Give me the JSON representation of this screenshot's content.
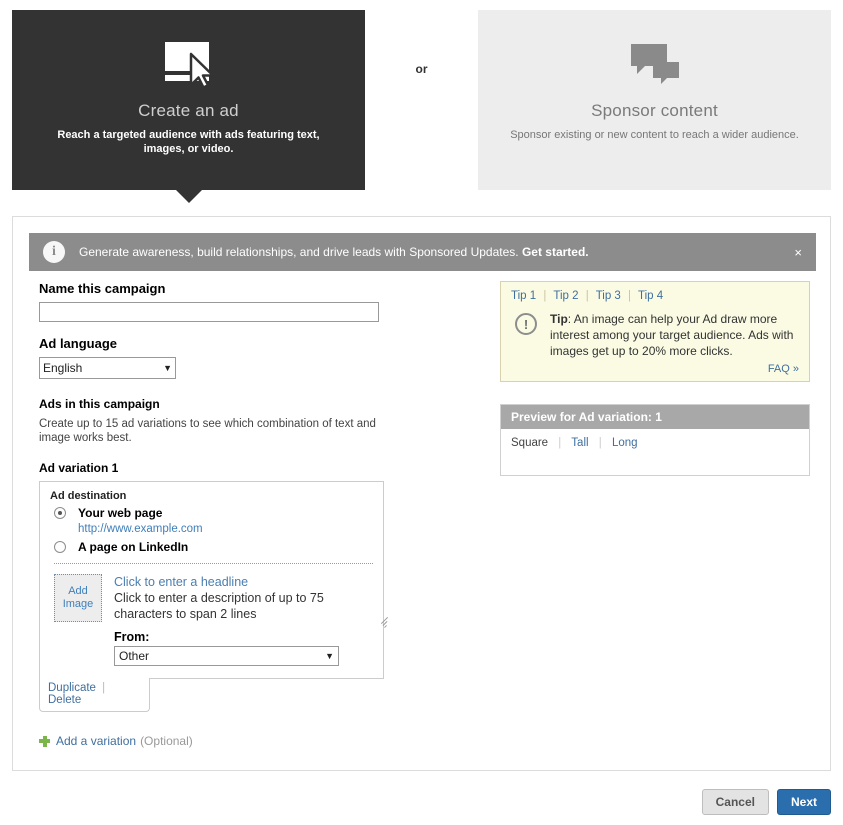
{
  "choice": {
    "create_card": {
      "icon": "ad-display-cursor-icon",
      "title": "Create an ad",
      "subtitle": "Reach a targeted audience with ads featuring text, images, or video."
    },
    "or_label": "or",
    "sponsor_card": {
      "icon": "speech-bubbles-icon",
      "title": "Sponsor content",
      "subtitle": "Sponsor existing or new content to reach a wider audience."
    }
  },
  "banner": {
    "icon": "info-icon",
    "text": "Generate awareness, build relationships, and drive leads with Sponsored Updates.",
    "cta": "Get started.",
    "close_label": "×"
  },
  "form": {
    "campaign_name_label": "Name this campaign",
    "campaign_name_value": "",
    "campaign_name_placeholder": "",
    "ad_language_label": "Ad language",
    "ad_language_value": "English",
    "ads_section_title": "Ads in this campaign",
    "ads_section_help": "Create up to 15 ad variations to see which combination of text and image works best.",
    "variation_title": "Ad variation 1"
  },
  "variation": {
    "destination_label": "Ad destination",
    "option_webpage": "Your web page",
    "url_value": "http://www.example.com",
    "option_linkedin": "A page on LinkedIn",
    "add_image_label": "Add Image",
    "headline_placeholder": "Click to enter a headline",
    "description_placeholder": "Click to enter a description of up to 75 characters to span 2 lines",
    "from_label": "From:",
    "from_value": "Other",
    "duplicate_label": "Duplicate",
    "delete_label": "Delete",
    "separator": "|"
  },
  "add_variation": {
    "icon": "plus-icon",
    "link_label": "Add a variation",
    "optional_label": "(Optional)"
  },
  "tips": {
    "tabs": [
      "Tip 1",
      "Tip 2",
      "Tip 3",
      "Tip 4"
    ],
    "icon": "exclamation-icon",
    "label": "Tip",
    "text": ": An image can help your Ad draw more interest among your target audience. Ads with images get up to 20% more clicks.",
    "faq_label": "FAQ »"
  },
  "preview": {
    "header": "Preview for Ad variation: 1",
    "tabs": [
      "Square",
      "Tall",
      "Long"
    ]
  },
  "footer": {
    "cancel_label": "Cancel",
    "next_label": "Next"
  },
  "colors": {
    "dark_card": "#333333",
    "light_card": "#ededed",
    "banner_gray": "#8c8c8c",
    "link_blue": "#3f6f9f",
    "tips_bg": "#fbfbe4",
    "primary_button": "#2a6ead",
    "plus_green": "#7ab648"
  }
}
